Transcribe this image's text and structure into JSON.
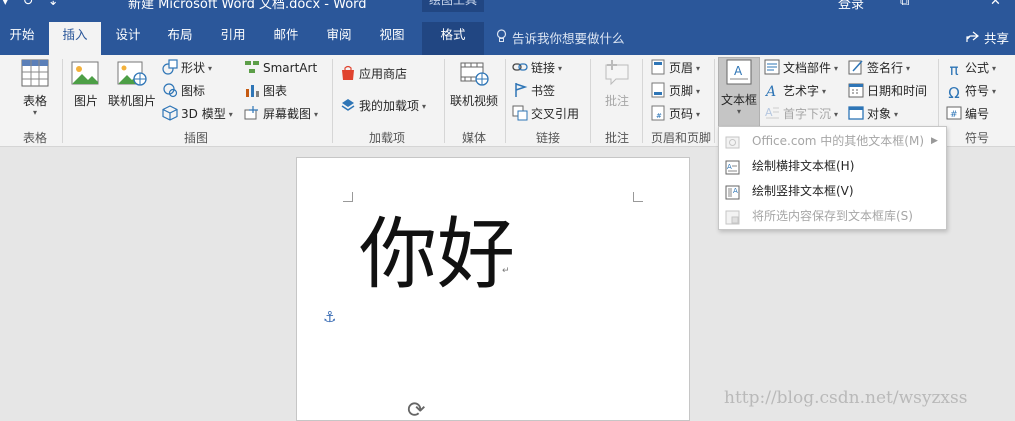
{
  "titlebar": {
    "qa_items": [
      "▾",
      "↻",
      "⇣"
    ],
    "document_title": "新建 Microsoft Word 文档.docx - Word",
    "context_tools": "绘图工具",
    "login": "登录",
    "restore_glyph": "⧉",
    "close_glyph": "✕"
  },
  "tabs": [
    {
      "label": "开始"
    },
    {
      "label": "插入"
    },
    {
      "label": "设计"
    },
    {
      "label": "布局"
    },
    {
      "label": "引用"
    },
    {
      "label": "邮件"
    },
    {
      "label": "审阅"
    },
    {
      "label": "视图"
    },
    {
      "label": "格式"
    }
  ],
  "tellme": {
    "placeholder": "告诉我你想要做什么"
  },
  "share": {
    "label": "共享"
  },
  "ribbon": {
    "table_group": {
      "table_label": "表格",
      "group_label": "表格"
    },
    "illustrations": {
      "picture": "图片",
      "online_picture": "联机图片",
      "shapes": "形状",
      "icons": "图标",
      "model3d": "3D 模型",
      "smartart": "SmartArt",
      "chart": "图表",
      "screenshot": "屏幕截图",
      "group_label": "插图"
    },
    "addins": {
      "store": "应用商店",
      "my_addins": "我的加载项",
      "group_label": "加载项"
    },
    "media": {
      "online_video": "联机视频",
      "group_label": "媒体"
    },
    "links": {
      "link": "链接",
      "bookmark": "书签",
      "cross_ref": "交叉引用",
      "group_label": "链接"
    },
    "comments": {
      "comment": "批注",
      "group_label": "批注"
    },
    "header_footer": {
      "header": "页眉",
      "footer": "页脚",
      "page_number": "页码",
      "group_label": "页眉和页脚"
    },
    "text": {
      "textbox": "文本框",
      "quick_parts": "文档部件",
      "wordart": "艺术字",
      "drop_cap": "首字下沉",
      "signature_line": "签名行",
      "date_time": "日期和时间",
      "object": "对象"
    },
    "symbols": {
      "equation": "公式",
      "symbol": "符号",
      "numbering": "编号",
      "group_label": "符号"
    }
  },
  "document": {
    "content_text": "你好"
  },
  "watermark": {
    "text": "http://blog.csdn.net/wsyzxss"
  },
  "textbox_menu": {
    "items": [
      {
        "label": "Office.com 中的其他文本框(M)",
        "enabled": false
      },
      {
        "label": "绘制横排文本框(H)",
        "enabled": true
      },
      {
        "label": "绘制竖排文本框(V)",
        "enabled": true
      },
      {
        "label": "将所选内容保存到文本框库(S)",
        "enabled": false
      }
    ]
  },
  "colors": {
    "accent": "#2b579a",
    "ribbon_bg": "#f3f3f3",
    "workspace_bg": "#e6e6e6"
  }
}
